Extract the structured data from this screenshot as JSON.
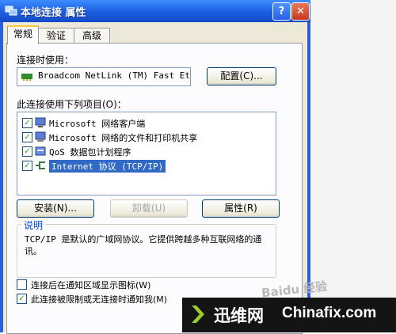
{
  "window": {
    "title": "本地连接 属性",
    "help_glyph": "?",
    "close_glyph": "✕"
  },
  "tabs": [
    {
      "label": "常规",
      "active": true
    },
    {
      "label": "验证",
      "active": false
    },
    {
      "label": "高级",
      "active": false
    }
  ],
  "connect_using": {
    "label": "连接时使用：",
    "adapter": "Broadcom NetLink (TM) Fast Eth",
    "config_button": "配置(C)..."
  },
  "items_section": {
    "label": "此连接使用下列项目(O)：",
    "items": [
      {
        "label": "Microsoft 网络客户端",
        "checked": true,
        "icon": "network-client-icon",
        "selected": false
      },
      {
        "label": "Microsoft 网络的文件和打印机共享",
        "checked": true,
        "icon": "file-printer-sharing-icon",
        "selected": false
      },
      {
        "label": "QoS 数据包计划程序",
        "checked": true,
        "icon": "qos-scheduler-icon",
        "selected": false
      },
      {
        "label": "Internet 协议 (TCP/IP)",
        "checked": true,
        "icon": "protocol-icon",
        "selected": true
      }
    ]
  },
  "buttons": {
    "install": "安装(N)...",
    "uninstall": "卸载(U)",
    "properties": "属性(R)"
  },
  "description": {
    "title": "说明",
    "text": "TCP/IP 是默认的广域网协议。它提供跨越多种互联网络的通讯。"
  },
  "options": [
    {
      "label": "连接后在通知区域显示图标(W)",
      "checked": false
    },
    {
      "label": "此连接被限制或无连接时通知我(M)",
      "checked": true
    }
  ],
  "overlay": {
    "watermark": "Baidu 经验",
    "brand_cn": "迅维网",
    "brand_en": "Chinafix.com"
  },
  "colors": {
    "titlebar": "#1b5fe0",
    "selection": "#316ac5",
    "group_title": "#0046d5",
    "check": "#21a121"
  }
}
